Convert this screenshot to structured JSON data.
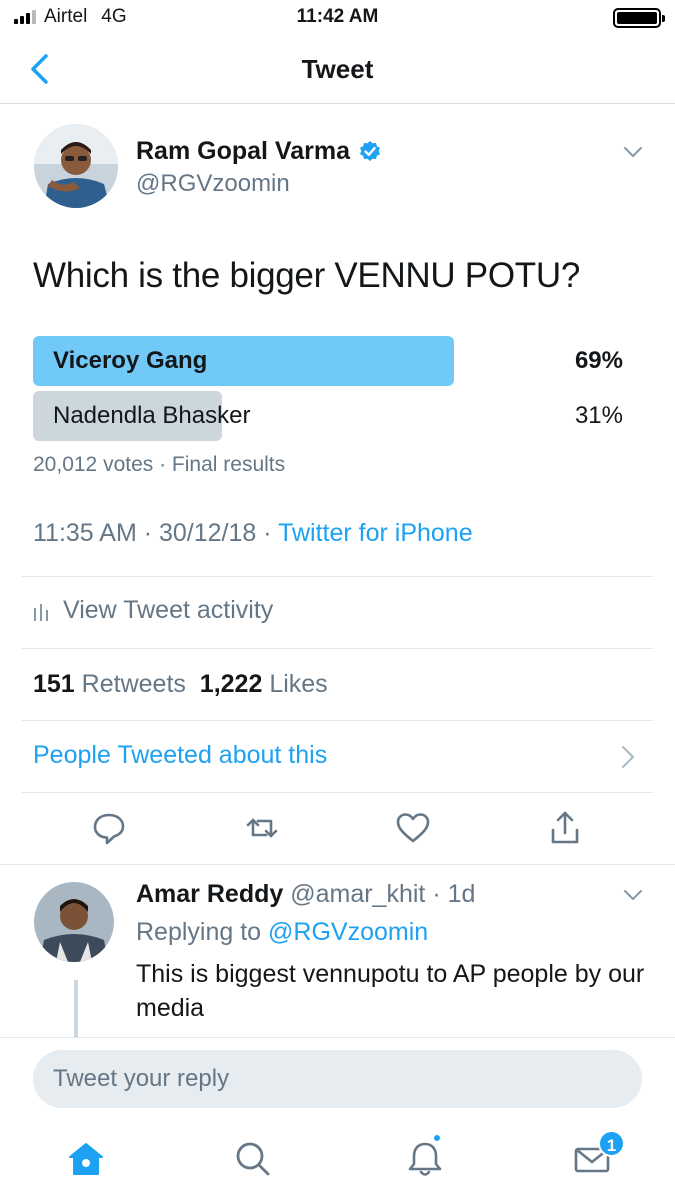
{
  "status_bar": {
    "carrier": "Airtel",
    "network": "4G",
    "time": "11:42 AM"
  },
  "nav": {
    "title": "Tweet"
  },
  "tweet": {
    "author_name": "Ram Gopal Varma",
    "handle": "@RGVzoomin",
    "verified": true,
    "text": "Which is the bigger VENNU POTU?",
    "poll": {
      "options": [
        {
          "label": "Viceroy Gang",
          "percent_text": "69%",
          "percent": 69,
          "winner": true
        },
        {
          "label": "Nadendla Bhasker",
          "percent_text": "31%",
          "percent": 31,
          "winner": false
        }
      ],
      "meta": "20,012 votes · Final results"
    },
    "timestamp": "11:35 AM · 30/12/18 · ",
    "source": "Twitter for iPhone",
    "activity_label": "View Tweet activity",
    "retweets_count": "151",
    "retweets_label": "Retweets",
    "likes_count": "1,222",
    "likes_label": "Likes",
    "people_tweeted": "People Tweeted about this"
  },
  "reply": {
    "name": "Amar Reddy",
    "handle": "@amar_khit",
    "age": "· 1d",
    "replying_prefix": "Replying to",
    "replying_handle": "@RGVzoomin",
    "text": "This is biggest vennupotu to AP people by our media"
  },
  "composer": {
    "placeholder": "Tweet your reply"
  },
  "tabbar": {
    "messages_badge": "1"
  },
  "colors": {
    "accent": "#1da1f2",
    "poll_winner": "#71c9f8",
    "poll_other": "#ccd6dd",
    "muted_text": "#657786"
  }
}
